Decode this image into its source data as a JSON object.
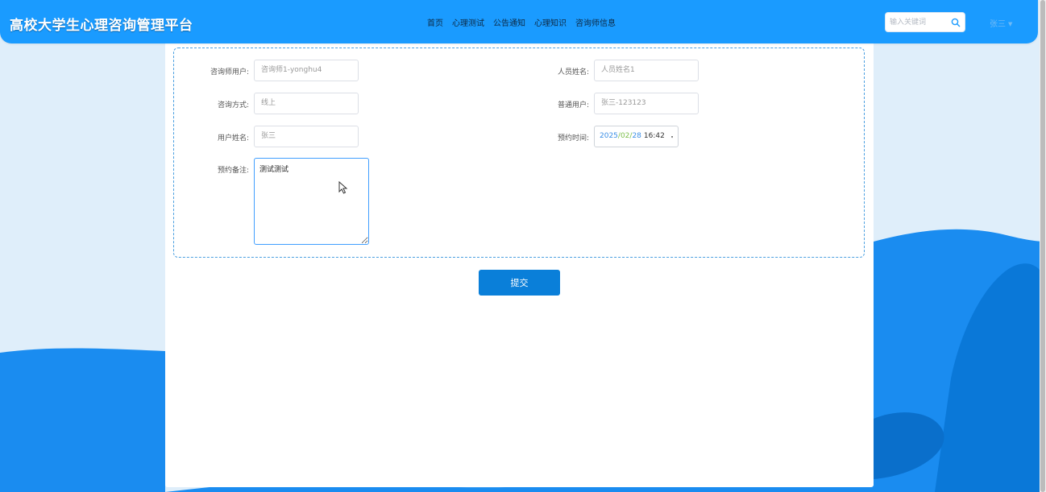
{
  "header": {
    "site_title": "高校大学生心理咨询管理平台",
    "nav": [
      "首页",
      "心理测试",
      "公告通知",
      "心理知识",
      "咨询师信息"
    ],
    "search": {
      "placeholder": "输入关键词",
      "value": ""
    },
    "user": {
      "name": "张三"
    }
  },
  "form": {
    "counselor_user": {
      "label": "咨询师用户:",
      "value": "咨询师1-yonghu4"
    },
    "person_name": {
      "label": "人员姓名:",
      "value": "人员姓名1"
    },
    "consult_method": {
      "label": "咨询方式:",
      "value": "线上"
    },
    "regular_user": {
      "label": "普通用户:",
      "value": "张三-123123"
    },
    "user_name": {
      "label": "用户姓名:",
      "value": "张三"
    },
    "appointment_time": {
      "label": "预约时间:",
      "year": "2025",
      "month": "02",
      "day": "28",
      "sep": "/",
      "time": "16:42"
    },
    "appointment_note": {
      "label": "预约备注:",
      "value": "测试测试"
    },
    "submit_label": "提交"
  },
  "colors": {
    "header": "#1a9bff",
    "primary_button": "#0a7fd9",
    "background": "#dfeefa",
    "wave": "#1a8cf0"
  }
}
